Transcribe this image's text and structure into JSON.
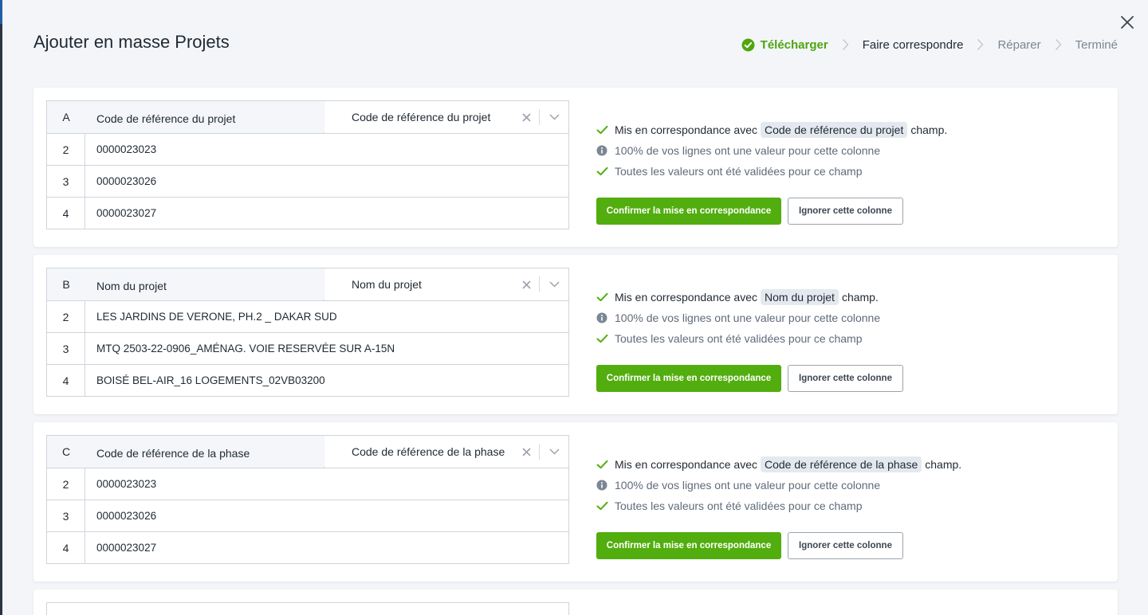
{
  "modal": {
    "title": "Ajouter en masse Projets",
    "close_icon": "close-icon"
  },
  "stepper": {
    "steps": [
      {
        "label": "Télécharger",
        "state": "done"
      },
      {
        "label": "Faire correspondre",
        "state": "active"
      },
      {
        "label": "Réparer",
        "state": "pending"
      },
      {
        "label": "Terminé",
        "state": "pending"
      }
    ]
  },
  "colors": {
    "success": "#52ad0e",
    "muted_text": "#5f6b7a",
    "chip_bg": "#e4e9f0"
  },
  "cards": [
    {
      "letter": "A",
      "column_name": "Code de référence du projet",
      "selected_field": "Code de référence du projet",
      "rows": [
        {
          "num": "2",
          "value": "0000023023"
        },
        {
          "num": "3",
          "value": "0000023026"
        },
        {
          "num": "4",
          "value": "0000023027"
        }
      ],
      "matched_prefix": "Mis en correspondance avec",
      "matched_field": "Code de référence du projet",
      "matched_suffix": "champ.",
      "fill_rate": "100% de vos lignes ont une valeur pour cette colonne",
      "validation": "Toutes les valeurs ont été validées pour ce champ",
      "confirm_label": "Confirmer la mise en correspondance",
      "ignore_label": "Ignorer cette colonne"
    },
    {
      "letter": "B",
      "column_name": "Nom du projet",
      "selected_field": "Nom du projet",
      "rows": [
        {
          "num": "2",
          "value": "LES JARDINS DE VERONE, PH.2 _ DAKAR SUD"
        },
        {
          "num": "3",
          "value": "MTQ 2503-22-0906_AMÉNAG. VOIE RESERVÉE SUR A-15N"
        },
        {
          "num": "4",
          "value": "BOISÉ BEL-AIR_16 LOGEMENTS_02VB03200"
        }
      ],
      "matched_prefix": "Mis en correspondance avec",
      "matched_field": "Nom du projet",
      "matched_suffix": "champ.",
      "fill_rate": "100% de vos lignes ont une valeur pour cette colonne",
      "validation": "Toutes les valeurs ont été validées pour ce champ",
      "confirm_label": "Confirmer la mise en correspondance",
      "ignore_label": "Ignorer cette colonne"
    },
    {
      "letter": "C",
      "column_name": "Code de référence de la phase",
      "selected_field": "Code de référence de la phase",
      "rows": [
        {
          "num": "2",
          "value": "0000023023"
        },
        {
          "num": "3",
          "value": "0000023026"
        },
        {
          "num": "4",
          "value": "0000023027"
        }
      ],
      "matched_prefix": "Mis en correspondance avec",
      "matched_field": "Code de référence de la phase",
      "matched_suffix": "champ.",
      "fill_rate": "100% de vos lignes ont une valeur pour cette colonne",
      "validation": "Toutes les valeurs ont été validées pour ce champ",
      "confirm_label": "Confirmer la mise en correspondance",
      "ignore_label": "Ignorer cette colonne"
    }
  ]
}
